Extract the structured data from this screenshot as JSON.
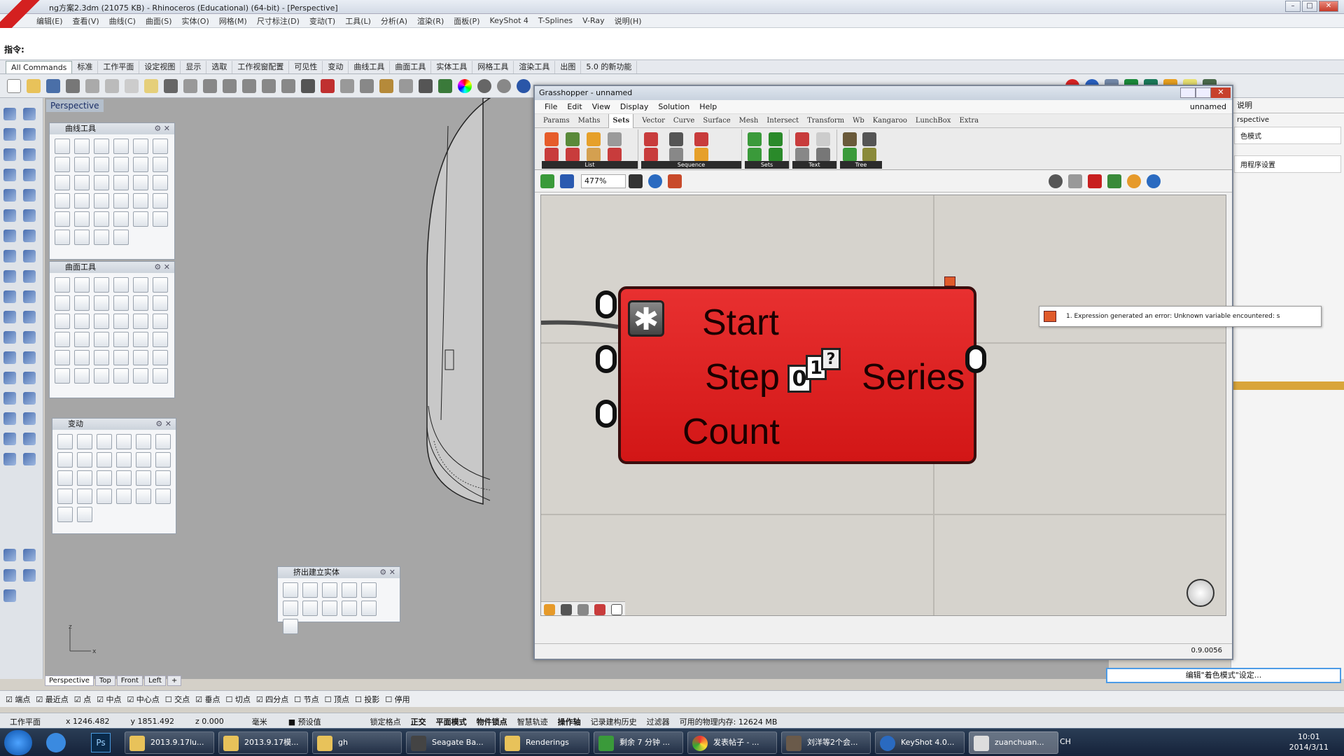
{
  "rhino": {
    "title": "ng方案2.3dm (21075 KB) - Rhinoceros (Educational) (64-bit) - [Perspective]",
    "menus": [
      "编辑(E)",
      "查看(V)",
      "曲线(C)",
      "曲面(S)",
      "实体(O)",
      "网格(M)",
      "尺寸标注(D)",
      "变动(T)",
      "工具(L)",
      "分析(A)",
      "渲染(R)",
      "面板(P)",
      "KeyShot 4",
      "T-Splines",
      "V-Ray",
      "说明(H)"
    ],
    "command_label": "指令:",
    "tabs": [
      "All Commands",
      "标准",
      "工作平面",
      "设定视图",
      "显示",
      "选取",
      "工作视窗配置",
      "可见性",
      "变动",
      "曲线工具",
      "曲面工具",
      "实体工具",
      "网格工具",
      "渲染工具",
      "出图",
      "5.0 的新功能"
    ],
    "viewport_title": "Perspective",
    "panels": {
      "curve_tools": "曲线工具",
      "surface_tools": "曲面工具",
      "transform": "变动",
      "extrude": "挤出建立实体"
    },
    "viewport_tabs": [
      "Perspective",
      "Top",
      "Front",
      "Left"
    ],
    "osnaps": [
      {
        "label": "端点",
        "checked": true
      },
      {
        "label": "最近点",
        "checked": true
      },
      {
        "label": "点",
        "checked": true
      },
      {
        "label": "中点",
        "checked": true
      },
      {
        "label": "中心点",
        "checked": true
      },
      {
        "label": "交点",
        "checked": false
      },
      {
        "label": "垂点",
        "checked": true
      },
      {
        "label": "切点",
        "checked": false
      },
      {
        "label": "四分点",
        "checked": true
      },
      {
        "label": "节点",
        "checked": false
      },
      {
        "label": "顶点",
        "checked": false
      },
      {
        "label": "投影",
        "checked": false
      },
      {
        "label": "停用",
        "checked": false
      }
    ],
    "status": {
      "cplane": "工作平面",
      "x": "x 1246.482",
      "y": "y 1851.492",
      "z": "z 0.000",
      "units": "毫米",
      "layer": "预设值",
      "modes": [
        "锁定格点",
        "正交",
        "平面模式",
        "物件锁点",
        "智慧轨迹",
        "操作轴",
        "记录建构历史",
        "过滤器"
      ],
      "memory": "可用的物理内存: 12624 MB"
    },
    "right_panel": {
      "tab": "说明",
      "items": [
        "rspective",
        "色模式",
        "用程序设置"
      ],
      "button": "编辑\"着色模式\"设定..."
    }
  },
  "gh": {
    "title": "Grasshopper - unnamed",
    "doc_name": "unnamed",
    "menus": [
      "File",
      "Edit",
      "View",
      "Display",
      "Solution",
      "Help"
    ],
    "tabs": [
      "Params",
      "Maths",
      "Sets",
      "Vector",
      "Curve",
      "Surface",
      "Mesh",
      "Intersect",
      "Transform",
      "Wb",
      "Kangaroo",
      "LunchBox",
      "Extra"
    ],
    "active_tab": "Sets",
    "groups": [
      "List",
      "Sequence",
      "Sets",
      "Text",
      "Tree"
    ],
    "zoom": "477%",
    "version": "0.9.0056",
    "component": {
      "inputs": [
        "Start",
        "Step",
        "Count"
      ],
      "output": "Series",
      "state_color": "#dc2020"
    },
    "error": "1. Expression generated an error: Unknown variable encountered: s"
  },
  "taskbar": {
    "items": [
      "2013.9.17lu...",
      "2013.9.17模...",
      "gh",
      "Seagate Ba...",
      "Renderings",
      "剩余 7 分钟 ...",
      "发表帖子 - ...",
      "刘洋等2个会...",
      "KeyShot 4.0...",
      "zuanchuan..."
    ],
    "lang": "CH",
    "time": "10:01",
    "date": "2014/3/11"
  }
}
